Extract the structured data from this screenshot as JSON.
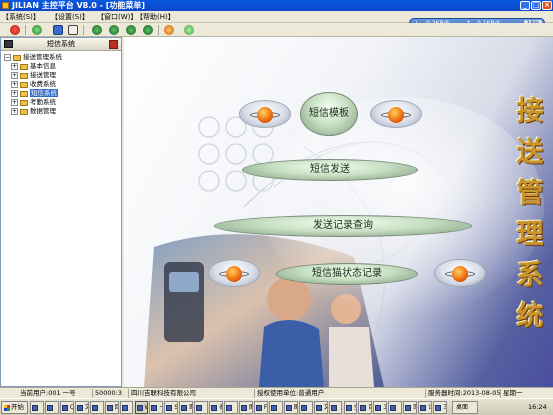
{
  "window": {
    "title": "JILIAN 主控平台 V8.0 - [功能菜单]",
    "controls": [
      "_",
      "□",
      "×"
    ]
  },
  "menu": [
    "【系统(S)】",
    "【设置(S)】",
    "【窗口(W)】",
    "【帮助(H)】"
  ],
  "toolbar_icons": [
    "power-icon",
    "refresh-icon",
    "list-icon",
    "window-icon",
    "nav-first-icon",
    "nav-prev-icon",
    "nav-next-icon",
    "nav-last-icon",
    "favorite-icon",
    "check-icon"
  ],
  "netspeed": {
    "down": "0.2KB/S",
    "up": "0.1KB/S",
    "cpu": "18%"
  },
  "left_panel": {
    "title": "短信系统",
    "tree": [
      {
        "label": "接送管理系统",
        "level": 0,
        "expander": "−"
      },
      {
        "label": "基本信息",
        "level": 1,
        "expander": "+"
      },
      {
        "label": "接送管理",
        "level": 1,
        "expander": "+"
      },
      {
        "label": "收费系统",
        "level": 1,
        "expander": "+"
      },
      {
        "label": "短信系统",
        "level": 1,
        "expander": "+",
        "selected": true
      },
      {
        "label": "考勤系统",
        "level": 1,
        "expander": "+"
      },
      {
        "label": "数据管理",
        "level": 1,
        "expander": "+"
      }
    ]
  },
  "main": {
    "vertical_title": [
      "接",
      "送",
      "管",
      "理",
      "系",
      "统"
    ],
    "buttons": {
      "template": "短信模板",
      "send": "短信发送",
      "history": "发送记录查询",
      "modem": "短信猫状态记录"
    },
    "accent": "#c8962a"
  },
  "statusbar": {
    "user": "当前用户:001 一号",
    "port": "50000:3",
    "company": "四川吉联科技有限公司",
    "licensee": "授权使用单位:普通用户",
    "server_time": "服务器时间:2013-08-05",
    "weekday": "星期一"
  },
  "taskbar": {
    "start": "开始",
    "buttons": [
      "",
      "",
      "Q",
      "文",
      "",
      "回",
      "",
      "W",
      "卡",
      "S",
      "图",
      "",
      "表",
      "",
      "图",
      "F",
      "",
      "图",
      "",
      "文",
      "",
      "全",
      "百",
      "文",
      "",
      "回",
      "计",
      "王"
    ],
    "tray_label": "桌面",
    "time": "16:24"
  }
}
